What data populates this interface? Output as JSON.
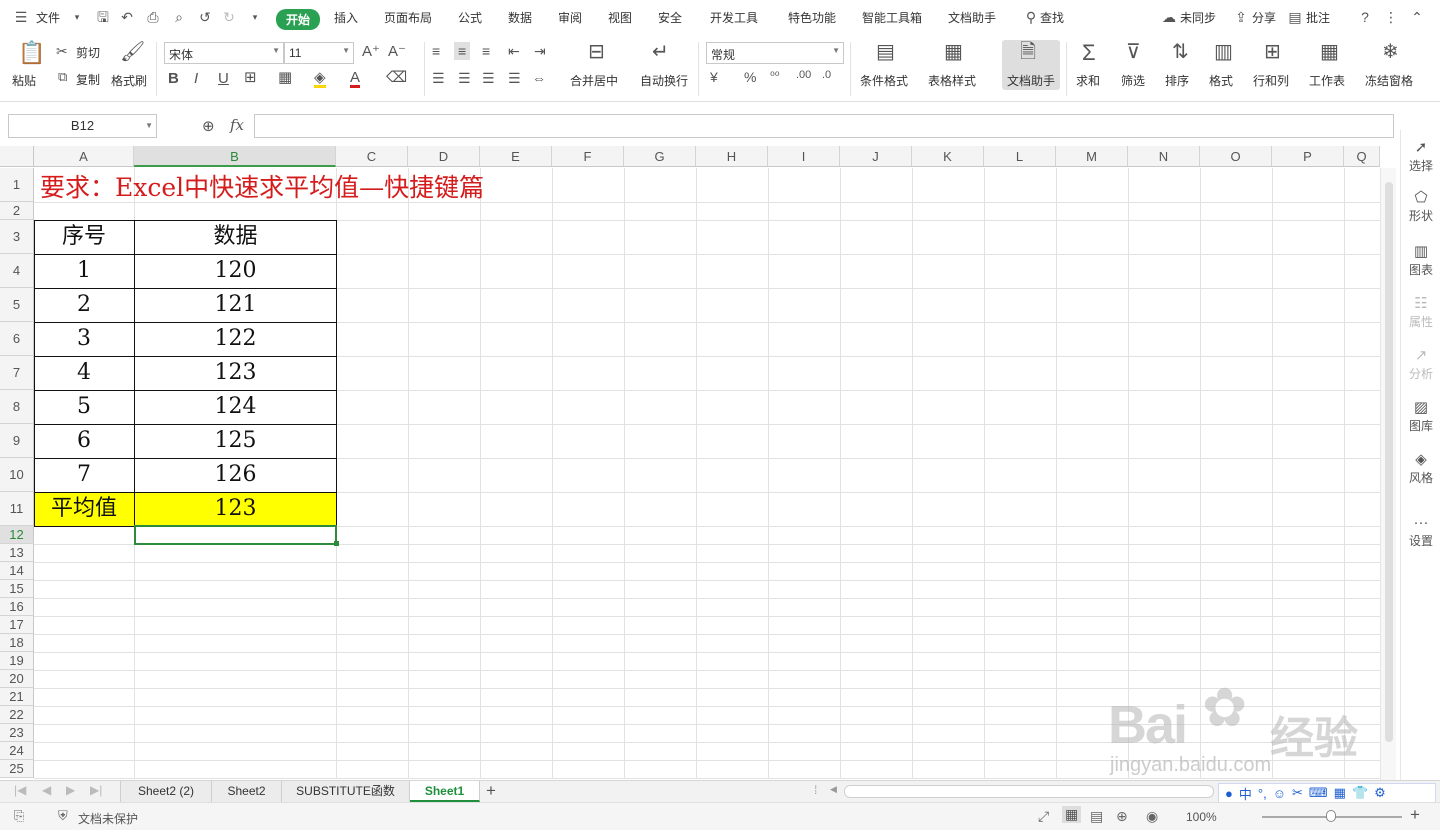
{
  "menubar": {
    "file_label": "文件",
    "tabs": [
      "开始",
      "插入",
      "页面布局",
      "公式",
      "数据",
      "审阅",
      "视图",
      "安全",
      "开发工具",
      "特色功能",
      "智能工具箱",
      "文档助手"
    ],
    "search_label": "查找",
    "sync_label": "未同步",
    "share_label": "分享",
    "comment_label": "批注"
  },
  "ribbon": {
    "paste": "粘贴",
    "cut": "剪切",
    "copy": "复制",
    "format_painter": "格式刷",
    "font_name": "宋体",
    "font_size": "11",
    "merge_center": "合并居中",
    "wrap_text": "自动换行",
    "number_format": "常规",
    "cond_format": "条件格式",
    "table_style": "表格样式",
    "doc_assistant": "文档助手",
    "sum": "求和",
    "filter": "筛选",
    "sort": "排序",
    "format": "格式",
    "row_col": "行和列",
    "worksheet": "工作表",
    "freeze": "冻结窗格"
  },
  "formula_bar": {
    "name_box": "B12",
    "fx": "fx",
    "value": ""
  },
  "sheet": {
    "columns": [
      "A",
      "B",
      "C",
      "D",
      "E",
      "F",
      "G",
      "H",
      "I",
      "J",
      "K",
      "L",
      "M",
      "N",
      "O",
      "P",
      "Q"
    ],
    "rows": [
      "1",
      "2",
      "3",
      "4",
      "5",
      "6",
      "7",
      "8",
      "9",
      "10",
      "11",
      "12",
      "13",
      "14",
      "15",
      "16",
      "17",
      "18",
      "19",
      "20",
      "21",
      "22",
      "23",
      "24",
      "25"
    ],
    "title": "要求：Excel中快速求平均值—快捷键篇",
    "header_a": "序号",
    "header_b": "数据",
    "table": [
      {
        "a": "1",
        "b": "120"
      },
      {
        "a": "2",
        "b": "121"
      },
      {
        "a": "3",
        "b": "122"
      },
      {
        "a": "4",
        "b": "123"
      },
      {
        "a": "5",
        "b": "124"
      },
      {
        "a": "6",
        "b": "125"
      },
      {
        "a": "7",
        "b": "126"
      }
    ],
    "avg_label": "平均值",
    "avg_value": "123",
    "title_color": "#d51c1c",
    "highlight_color": "#ffff00"
  },
  "right_panel": [
    "选择",
    "形状",
    "图表",
    "属性",
    "分析",
    "图库",
    "风格",
    "设置"
  ],
  "sheet_tabs": [
    "Sheet2 (2)",
    "Sheet2",
    "SUBSTITUTE函数",
    "Sheet1"
  ],
  "status": {
    "protect": "文档未保护",
    "zoom": "100%"
  },
  "watermark": {
    "text1": "Bai",
    "text2": "经验",
    "url": "jingyan.baidu.com"
  }
}
